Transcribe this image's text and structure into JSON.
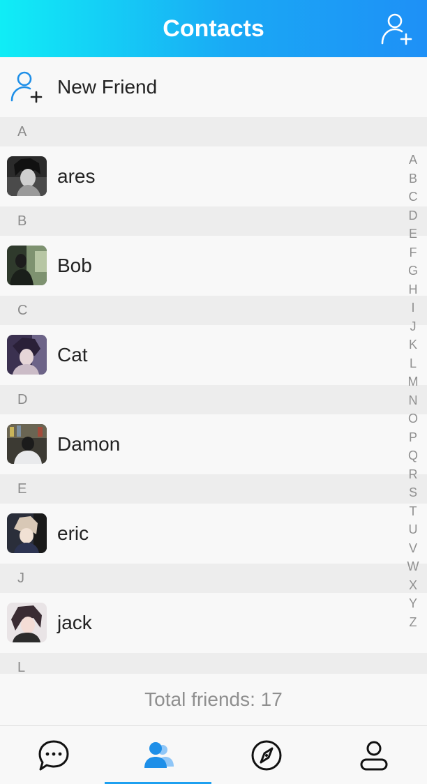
{
  "header": {
    "title": "Contacts",
    "add_icon": "add-user-icon"
  },
  "new_friend": {
    "label": "New Friend",
    "icon": "add-user-icon"
  },
  "sections": [
    {
      "letter": "A",
      "contacts": [
        {
          "name": "ares",
          "avatar": "ares-avatar"
        }
      ]
    },
    {
      "letter": "B",
      "contacts": [
        {
          "name": "Bob",
          "avatar": "bob-avatar"
        }
      ]
    },
    {
      "letter": "C",
      "contacts": [
        {
          "name": "Cat",
          "avatar": "cat-avatar"
        }
      ]
    },
    {
      "letter": "D",
      "contacts": [
        {
          "name": "Damon",
          "avatar": "damon-avatar"
        }
      ]
    },
    {
      "letter": "E",
      "contacts": [
        {
          "name": "eric",
          "avatar": "eric-avatar"
        }
      ]
    },
    {
      "letter": "J",
      "contacts": [
        {
          "name": "jack",
          "avatar": "jack-avatar"
        }
      ]
    },
    {
      "letter": "L",
      "contacts": []
    }
  ],
  "index_letters": [
    "A",
    "B",
    "C",
    "D",
    "E",
    "F",
    "G",
    "H",
    "I",
    "J",
    "K",
    "L",
    "M",
    "N",
    "O",
    "P",
    "Q",
    "R",
    "S",
    "T",
    "U",
    "V",
    "W",
    "X",
    "Y",
    "Z"
  ],
  "footer": {
    "total": "Total friends: 17"
  },
  "tabs": [
    {
      "name": "chats",
      "icon": "chat-bubble-icon",
      "active": false
    },
    {
      "name": "contacts",
      "icon": "contacts-icon",
      "active": true
    },
    {
      "name": "discover",
      "icon": "compass-icon",
      "active": false
    },
    {
      "name": "me",
      "icon": "person-icon",
      "active": false
    }
  ],
  "colors": {
    "header_gradient_start": "#10edf6",
    "header_gradient_end": "#1e90f6",
    "accent": "#1ea0f0",
    "section_bg": "#ededed"
  }
}
